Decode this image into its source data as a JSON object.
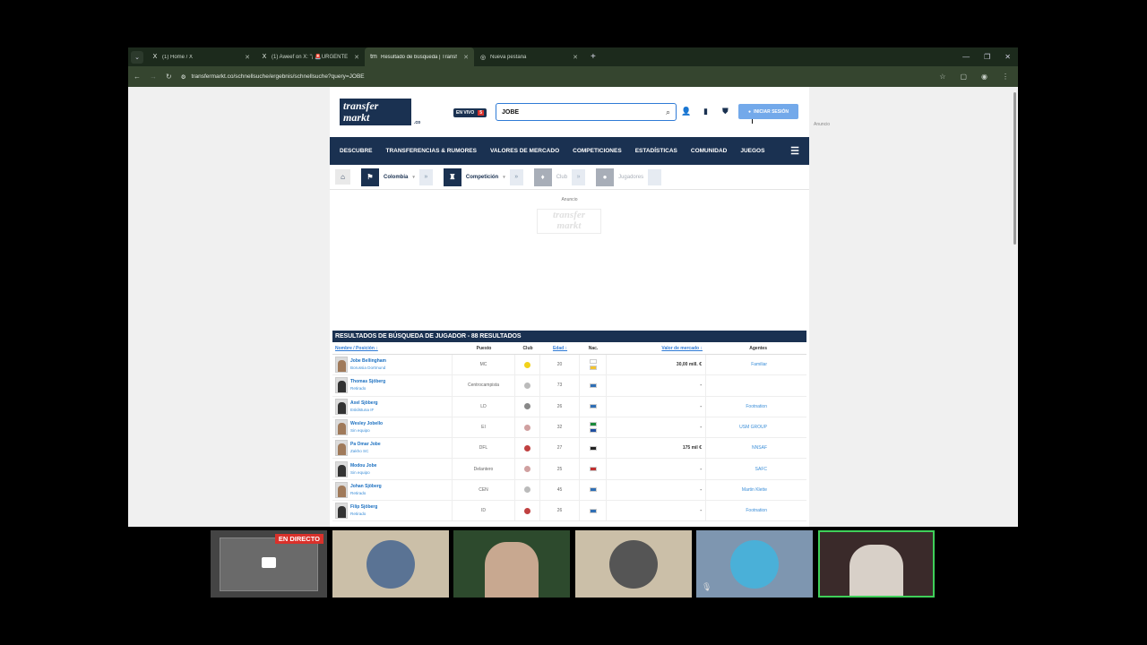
{
  "tabs": [
    {
      "icon": "X",
      "title": "(1) Home / X",
      "active": false
    },
    {
      "icon": "X",
      "title": "(1) Aweef on X: \"¡ 🚨URGENTE",
      "active": false
    },
    {
      "icon": "tm",
      "title": "Resultado de búsqueda | Transf",
      "active": true
    },
    {
      "icon": "◎",
      "title": "Nueva pestaña",
      "active": false
    }
  ],
  "address": {
    "url": "transfermarkt.co/schnellsuche/ergebnis/schnellsuche?query=JOBE"
  },
  "site": {
    "logo_line1": "transfer",
    "logo_line2": "markt",
    "logo_domain": ".co",
    "live_label": "EN VIVO",
    "live_count": "5",
    "search_value": "JOBE",
    "login_label": "INICIAR SESIÓN",
    "side_ad": "Anuncio",
    "nav": [
      "DESCUBRE",
      "TRANSFERENCIAS & RUMORES",
      "VALORES DE MERCADO",
      "COMPETICIONES",
      "ESTADÍSTICAS",
      "COMUNIDAD",
      "JUEGOS"
    ],
    "breadcrumb": {
      "country": "Colombia",
      "competition": "Competición",
      "club": "Club",
      "players": "Jugadores"
    },
    "ad_label": "Anuncio",
    "ad_logo_1": "transfer",
    "ad_logo_2": "markt"
  },
  "results": {
    "heading": "RESULTADOS DE BÚSQUEDA DE JUGADOR - 88 RESULTADOS",
    "columns": {
      "name": "Nombre / Posición ↕",
      "pos": "Puesto",
      "club": "Club",
      "age": "Edad ↕",
      "nat": "Nac.",
      "value": "Valor de mercado ↕",
      "agent": "Agentes"
    },
    "rows": [
      {
        "name": "Jobe Bellingham",
        "sub": "Borussia Dortmund",
        "pos": "MC",
        "age": "20",
        "value": "30,00 mill. €",
        "agent": "Familiar",
        "club_color": "#f2d21a",
        "flags": [
          "#ffffff",
          "#f2c230"
        ],
        "photo": true
      },
      {
        "name": "Thomas Sjöberg",
        "sub": "Retirado",
        "pos": "Centrocampista",
        "age": "73",
        "value": "-",
        "agent": "",
        "club_color": "#bbbbbb",
        "flags": [
          "#2f6fb5"
        ],
        "photo": false
      },
      {
        "name": "Axel Sjöberg",
        "sub": "Eskilstuna IF",
        "pos": "LD",
        "age": "26",
        "value": "-",
        "agent": "Footnation",
        "club_color": "#888888",
        "flags": [
          "#2f6fb5"
        ],
        "photo": false
      },
      {
        "name": "Wesley Jobello",
        "sub": "Sin equipo",
        "pos": "EI",
        "age": "32",
        "value": "-",
        "agent": "USM GROUP",
        "club_color": "#d0a0a0",
        "flags": [
          "#1a8a3a",
          "#1f4fa0"
        ],
        "photo": true
      },
      {
        "name": "Pa Omar Jobe",
        "sub": "Zakho SC",
        "pos": "DFL",
        "age": "27",
        "value": "175 mil €",
        "agent": "NNSAF",
        "club_color": "#c04040",
        "flags": [
          "#222222"
        ],
        "photo": true
      },
      {
        "name": "Modou Jobe",
        "sub": "Sin equipo",
        "pos": "Delantero",
        "age": "25",
        "value": "-",
        "agent": "SAFC",
        "club_color": "#d0a0a0",
        "flags": [
          "#c03030"
        ],
        "photo": false
      },
      {
        "name": "Johan Sjöberg",
        "sub": "Retirado",
        "pos": "CEN",
        "age": "45",
        "value": "-",
        "agent": "Martin Klette",
        "club_color": "#bbbbbb",
        "flags": [
          "#2f6fb5"
        ],
        "photo": true
      },
      {
        "name": "Filip Sjöberg",
        "sub": "Retirado",
        "pos": "ID",
        "age": "26",
        "value": "-",
        "agent": "Footnation",
        "club_color": "#c04040",
        "flags": [
          "#2f6fb5"
        ],
        "photo": false
      }
    ]
  },
  "call": {
    "live_label": "EN DIRECTO"
  }
}
